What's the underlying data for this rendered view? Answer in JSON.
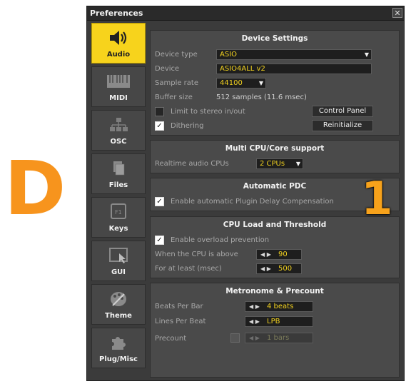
{
  "annotation": {
    "letter": "D",
    "marker": "1"
  },
  "window": {
    "title": "Preferences",
    "close": "✕"
  },
  "sidebar": {
    "items": [
      {
        "label": "Audio",
        "icon": "speaker-icon",
        "active": true
      },
      {
        "label": "MIDI",
        "icon": "midi-keyboard-icon"
      },
      {
        "label": "OSC",
        "icon": "network-icon"
      },
      {
        "label": "Files",
        "icon": "files-icon"
      },
      {
        "label": "Keys",
        "icon": "key-icon"
      },
      {
        "label": "GUI",
        "icon": "gui-window-icon"
      },
      {
        "label": "Theme",
        "icon": "palette-icon"
      },
      {
        "label": "Plug/Misc",
        "icon": "puzzle-icon"
      }
    ]
  },
  "device_settings": {
    "title": "Device Settings",
    "device_type_label": "Device type",
    "device_type_value": "ASIO",
    "device_label": "Device",
    "device_value": "ASIO4ALL v2",
    "sample_rate_label": "Sample rate",
    "sample_rate_value": "44100",
    "buffer_size_label": "Buffer size",
    "buffer_size_value": "512 samples (11.6 msec)",
    "limit_stereo_label": "Limit to stereo in/out",
    "limit_stereo_checked": false,
    "dithering_label": "Dithering",
    "dithering_checked": true,
    "control_panel_button": "Control Panel",
    "reinitialize_button": "Reinitialize"
  },
  "multi_cpu": {
    "title": "Multi CPU/Core support",
    "realtime_label": "Realtime audio CPUs",
    "realtime_value": "2 CPUs"
  },
  "automatic_pdc": {
    "title": "Automatic PDC",
    "enable_label": "Enable automatic Plugin Delay Compensation",
    "enable_checked": true
  },
  "cpu_load": {
    "title": "CPU Load and Threshold",
    "overload_label": "Enable overload prevention",
    "overload_checked": true,
    "cpu_above_label": "When the CPU is above",
    "cpu_above_value": "90",
    "at_least_label": "For at least (msec)",
    "at_least_value": "500"
  },
  "metronome": {
    "title": "Metronome & Precount",
    "beats_label": "Beats Per Bar",
    "beats_value": "4 beats",
    "lines_label": "Lines Per Beat",
    "lines_value": "LPB",
    "precount_label": "Precount",
    "precount_checked": false,
    "precount_value": "1 bars"
  },
  "colors": {
    "accent": "#f7d31c",
    "annotation": "#f7941d",
    "panel": "#4a4a4a"
  }
}
